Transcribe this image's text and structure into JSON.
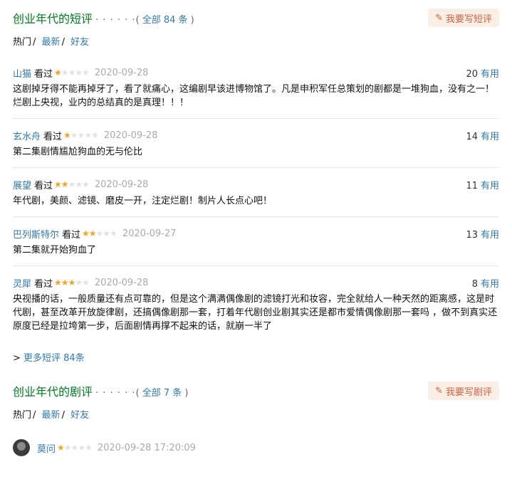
{
  "short": {
    "title": "创业年代的短评",
    "dots": "· · · · · ·",
    "total_prefix": "( ",
    "total_link": "全部 84 条",
    "total_suffix": " )",
    "write_label": "我要写短评",
    "tabs": [
      {
        "label": "热门",
        "sep": "/"
      },
      {
        "label": "最新",
        "sep": "/"
      },
      {
        "label": "好友",
        "sep": ""
      }
    ],
    "comments": [
      {
        "user": "山猫",
        "status": "看过",
        "rating": 1,
        "date": "2020-09-28",
        "votes": "20",
        "useful": "有用",
        "text": "这剧掉牙得不能再掉牙了，看了就痛心，这编剧早该进博物馆了。凡是申积军任总策划的剧都是一堆狗血，没有之一！烂剧上央视，业内的总结真的是真理！！！"
      },
      {
        "user": "玄水舟",
        "status": "看过",
        "rating": 1,
        "date": "2020-09-28",
        "votes": "14",
        "useful": "有用",
        "text": "第二集剧情尴尬狗血的无与伦比"
      },
      {
        "user": "展望",
        "status": "看过",
        "rating": 2,
        "date": "2020-09-28",
        "votes": "11",
        "useful": "有用",
        "text": "年代剧，美颜、滤镜、磨皮一开，注定烂剧！制片人长点心吧！"
      },
      {
        "user": "巴列斯特尔",
        "status": "看过",
        "rating": 2,
        "date": "2020-09-27",
        "votes": "13",
        "useful": "有用",
        "text": "第二集就开始狗血了"
      },
      {
        "user": "灵犀",
        "status": "看过",
        "rating": 3,
        "date": "2020-09-28",
        "votes": "8",
        "useful": "有用",
        "text": "央视播的话，一般质量还有点可靠的，但是这个满满偶像剧的滤镜打光和妆容，完全就给人一种天然的距离感，这是时代剧，甚至改革开放旋律剧，还搞偶像剧那一套，打着年代剧创业剧其实还是都市爱情偶像剧那一套吗 ，做不到真实还原度已经是拉垮第一步，后面剧情再撑不起来的话，就崩一半了"
      }
    ],
    "more_prefix": "> ",
    "more_label": "更多短评 84条"
  },
  "reviews": {
    "title": "创业年代的剧评",
    "dots": "· · · · · ·",
    "total_prefix": "( ",
    "total_link": "全部 7 条",
    "total_suffix": " )",
    "write_label": "我要写剧评",
    "tabs": [
      {
        "label": "热门",
        "sep": "/"
      },
      {
        "label": "最新",
        "sep": "/"
      },
      {
        "label": "好友",
        "sep": ""
      }
    ],
    "first": {
      "user": "莫问",
      "rating": 1,
      "date": "2020-09-28 17:20:09"
    }
  },
  "colors": {
    "green": "#007722",
    "link": "#3377aa",
    "star": "#f4a21f",
    "button_bg": "#fbeee4",
    "button_text": "#ca6445"
  }
}
